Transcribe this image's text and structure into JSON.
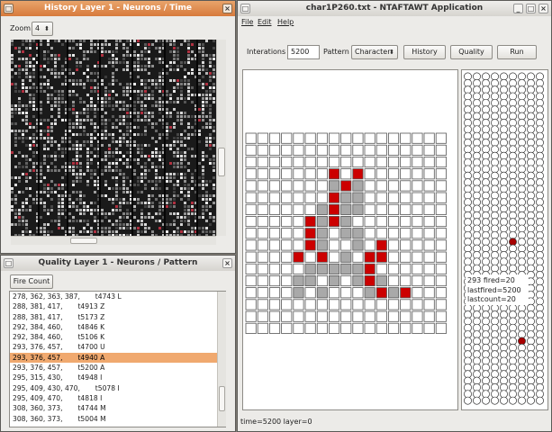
{
  "history_window": {
    "title": "History Layer 1 - Neurons / Time",
    "zoom_label": "Zoom",
    "zoom_value": "4"
  },
  "quality_window": {
    "title": "Quality Layer 1 - Neurons / Pattern",
    "fire_count_label": "Fire Count",
    "rows": [
      "278, 362, 363, 387,       t4743 L",
      "288, 381, 417,       t4913 Z",
      "288, 381, 417,       t5173 Z",
      "292, 384, 460,       t4846 K",
      "292, 384, 460,       t5106 K",
      "293, 376, 457,       t4700 U",
      "293, 376, 457,       t4940 A",
      "293, 376, 457,       t5200 A",
      "295, 315, 430,       t4948 I",
      "295, 409, 430, 470,       t5078 I",
      "295, 409, 470,       t4818 I",
      "308, 360, 373,       t4744 M",
      "308, 360, 373,       t5004 M"
    ],
    "selected_index": 6
  },
  "main_window": {
    "title": "char1P260.txt - NTAFTAWT Application",
    "menu": [
      "File",
      "Edit",
      "Help"
    ],
    "iterations_label": "Interations",
    "iterations_value": "5200",
    "pattern_label": "Pattern",
    "pattern_value": "Character",
    "history_button": "History",
    "quality_button": "Quality",
    "run_button": "Run",
    "neuron_info": [
      "293 fired=20",
      "lastfired=5200",
      "lastcount=20"
    ],
    "status": "time=5200 layer=0"
  },
  "pattern_grid": {
    "cols": 17,
    "rows": 17,
    "red_cells": [
      [
        3,
        7
      ],
      [
        3,
        9
      ],
      [
        4,
        8
      ],
      [
        5,
        7
      ],
      [
        6,
        7
      ],
      [
        7,
        5
      ],
      [
        7,
        7
      ],
      [
        8,
        5
      ],
      [
        9,
        5
      ],
      [
        9,
        11
      ],
      [
        10,
        4
      ],
      [
        10,
        6
      ],
      [
        10,
        10
      ],
      [
        10,
        11
      ],
      [
        11,
        10
      ],
      [
        12,
        10
      ],
      [
        13,
        11
      ],
      [
        13,
        13
      ]
    ],
    "gray_cells": [
      [
        4,
        7
      ],
      [
        4,
        9
      ],
      [
        5,
        8
      ],
      [
        5,
        9
      ],
      [
        6,
        6
      ],
      [
        6,
        8
      ],
      [
        6,
        9
      ],
      [
        7,
        6
      ],
      [
        7,
        8
      ],
      [
        8,
        6
      ],
      [
        8,
        8
      ],
      [
        8,
        9
      ],
      [
        9,
        6
      ],
      [
        9,
        9
      ],
      [
        10,
        8
      ],
      [
        11,
        5
      ],
      [
        11,
        6
      ],
      [
        11,
        7
      ],
      [
        11,
        8
      ],
      [
        11,
        9
      ],
      [
        12,
        4
      ],
      [
        12,
        5
      ],
      [
        12,
        7
      ],
      [
        12,
        9
      ],
      [
        12,
        11
      ],
      [
        13,
        4
      ],
      [
        13,
        6
      ],
      [
        13,
        10
      ],
      [
        13,
        12
      ]
    ],
    "colors": {
      "red": "#cc0000",
      "gray": "#a9a9a9",
      "empty": "#ffffff"
    }
  },
  "neuron_columns": {
    "cols": 9,
    "rows": 50,
    "fired": [
      [
        5,
        25
      ],
      [
        5,
        33
      ],
      [
        6,
        40
      ]
    ],
    "colors": {
      "fired": "#a80000",
      "idle": "#ffffff"
    }
  },
  "colors": {
    "title_active": "#de8b4e",
    "selection": "#f0a96f",
    "window_bg": "#ecebe8"
  }
}
